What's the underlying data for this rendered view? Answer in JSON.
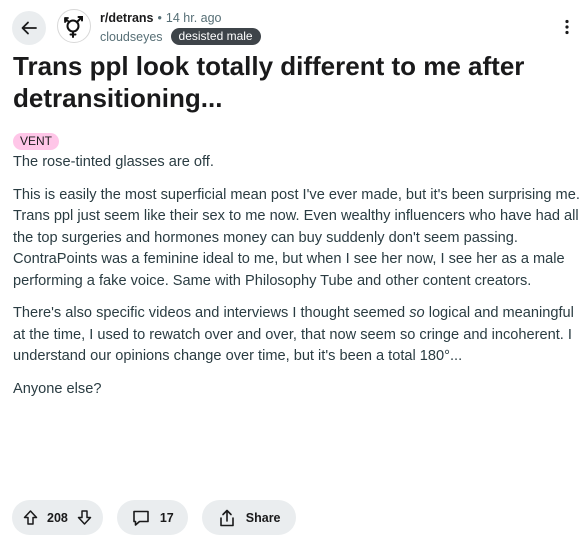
{
  "header": {
    "subreddit": "r/detrans",
    "separator": "•",
    "time": "14 hr. ago",
    "username": "cloudseyes",
    "user_flair": "desisted male"
  },
  "post": {
    "title": "Trans ppl look totally different to me after detransitioning...",
    "flair": "VENT",
    "paragraphs": [
      "The rose-tinted glasses are off.",
      "This is easily the most superficial mean post I've ever made, but it's been surprising me. Trans ppl just seem like their sex to me now. Even wealthy influencers who have had all the top surgeries and hormones money can buy suddenly don't seem passing. ContraPoints was a feminine ideal to me, but when I see her now, I see her as a male performing a fake voice. Same with Philosophy Tube and other content creators.",
      "There's also specific videos and interviews I thought seemed so logical and meaningful at the time, I used to rewatch over and over, that now seem so cringe and incoherent. I understand our opinions change over time, but it's been a total 180°...",
      "Anyone else?"
    ]
  },
  "actions": {
    "votes": "208",
    "comments": "17",
    "share_label": "Share"
  },
  "icons": {
    "back": "arrow-left-icon",
    "subreddit": "gender-symbol-icon",
    "more": "dots-vertical-icon",
    "upvote": "arrow-up-icon",
    "downvote": "arrow-down-icon",
    "comment": "speech-bubble-icon",
    "share": "share-icon"
  }
}
